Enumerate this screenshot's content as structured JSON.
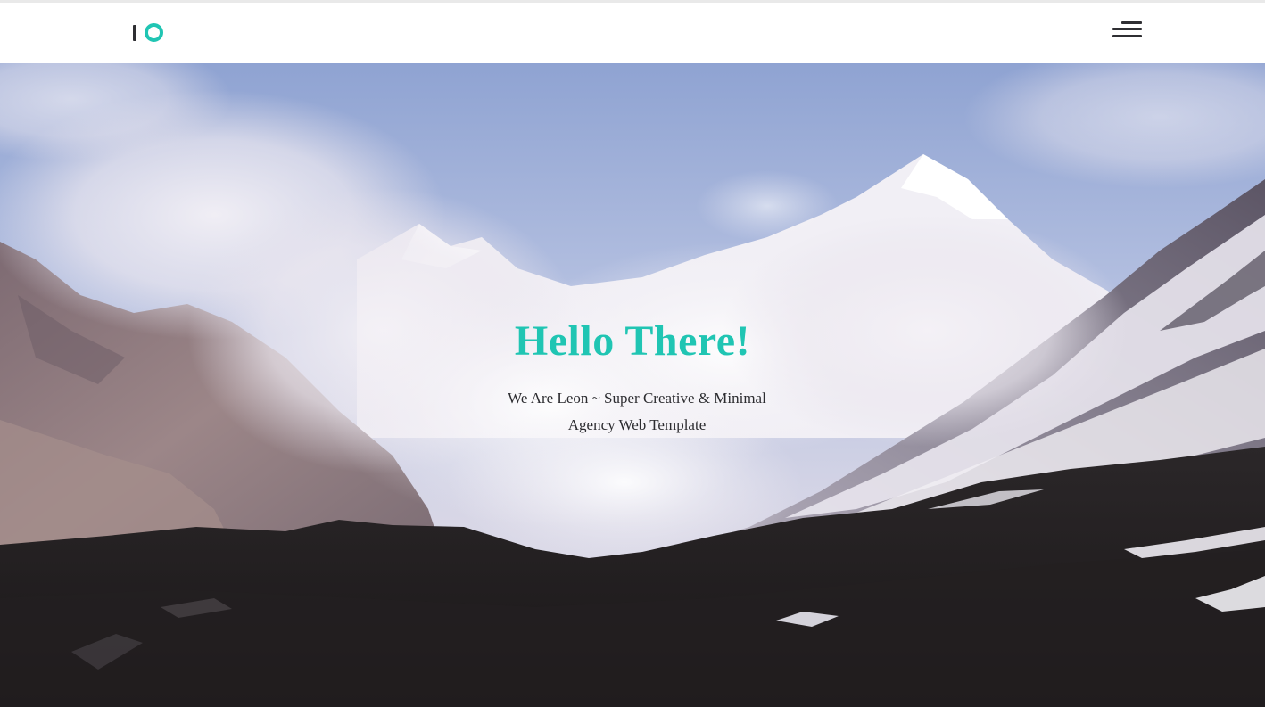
{
  "colors": {
    "accent": "#20c5b3",
    "logo_bar": "#2f2f33",
    "menu_lines": "#2f2f33",
    "nav_background": "#ffffff"
  },
  "header": {
    "logo_icon": "io-logo-icon",
    "menu_icon": "hamburger-menu-icon"
  },
  "hero": {
    "background": "snowy-mountain-valley-photo",
    "title": "Hello There!",
    "subtitle": "We Are Leon ~ Super Creative & Minimal Agency Web Template"
  }
}
